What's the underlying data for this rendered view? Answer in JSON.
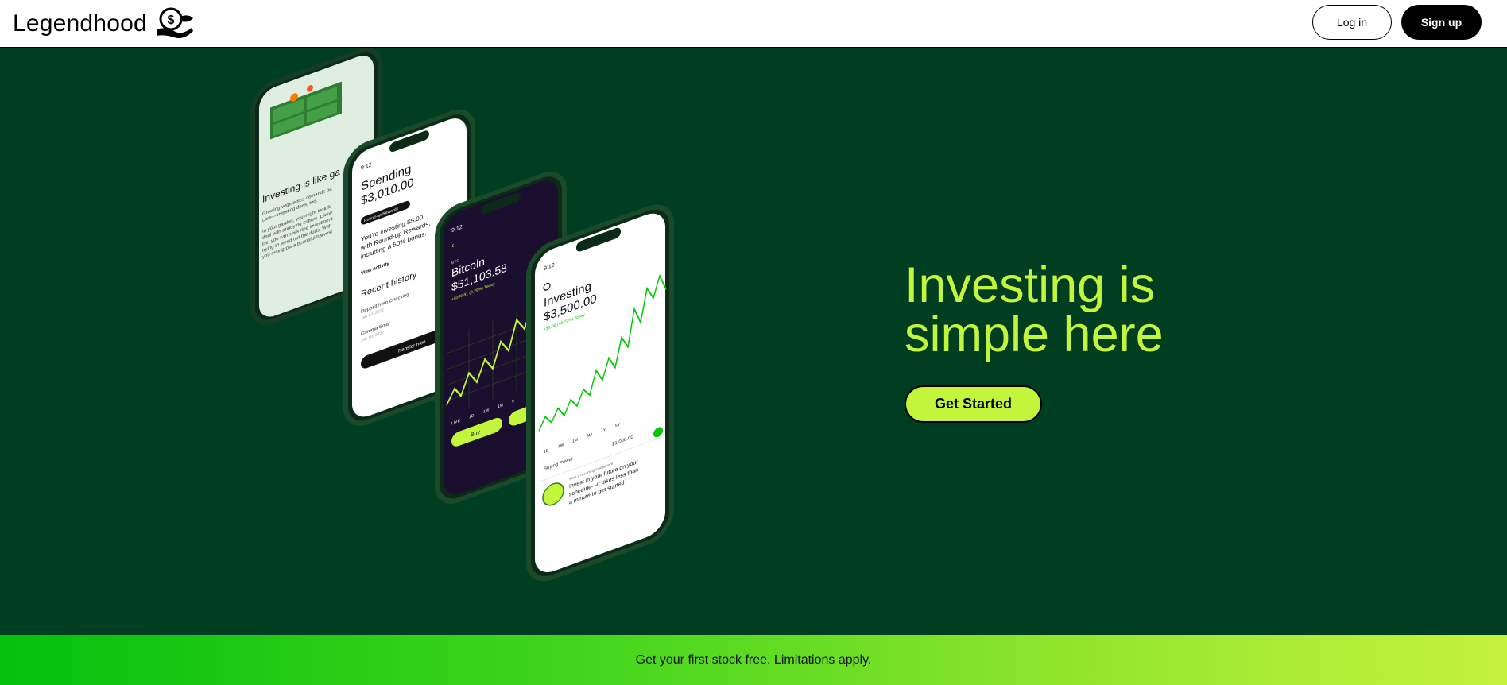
{
  "header": {
    "brand_name": "Legendhood",
    "logo_icon": "hand-dollar-coin-icon",
    "login_label": "Log in",
    "signup_label": "Sign up"
  },
  "hero": {
    "title_line1": "Investing is",
    "title_line2": "simple here",
    "cta_label": "Get Started",
    "colors": {
      "background": "#003e21",
      "accent": "#c3f53c"
    },
    "phone_garden": {
      "heading": "Investing is like ga",
      "body": [
        "Growing vegetables demands pa",
        "care—investing does, too.",
        "In your garden, you might look fo",
        "deal with annoying critters. Likew",
        "life, you can seek ripe investment",
        "trying to weed out the duds. With",
        "you may grow a bountiful harvest"
      ]
    },
    "phone_spending": {
      "time": "9:12",
      "title": "Spending",
      "amount": "$3,010.00",
      "badge": "Round-up Rewards",
      "message_line1": "You're investing $5.00",
      "message_line2": "with Round-up Rewards,",
      "message_line3": "including a 50% bonus.",
      "link": "View activity",
      "history_title": "Recent history",
      "history": [
        {
          "name": "Deposit from Checking",
          "date": "Jan 14, 2022"
        },
        {
          "name": "Chroma Solar",
          "date": "Jan 10, 2022"
        }
      ],
      "button": "Transfer mon"
    },
    "phone_bitcoin": {
      "time": "9:12",
      "ticker": "BTC",
      "title": "Bitcoin",
      "price": "$51,103.58",
      "change": "+$106.81 (0.29%) Today",
      "ranges": [
        "LIVE",
        "1D",
        "1W",
        "1M",
        "3"
      ],
      "buy": "Buy"
    },
    "phone_investing": {
      "time": "9:12",
      "title": "Investing",
      "amount": "$3,500.00",
      "change": "+$0.06 (+0.72%) Today",
      "ranges": [
        "1D",
        "1W",
        "1M",
        "3M",
        "1Y",
        "5Y"
      ],
      "buying_power_label": "Buying Power",
      "buying_power_value": "$1,000.00",
      "card_kicker": "Start a recurring investment",
      "card_text_line1": "Invest in your future on your",
      "card_text_line2": "schedule—it takes less than",
      "card_text_line3": "a minute to get started"
    }
  },
  "promo": {
    "text": "Get your first stock free. Limitations apply."
  }
}
